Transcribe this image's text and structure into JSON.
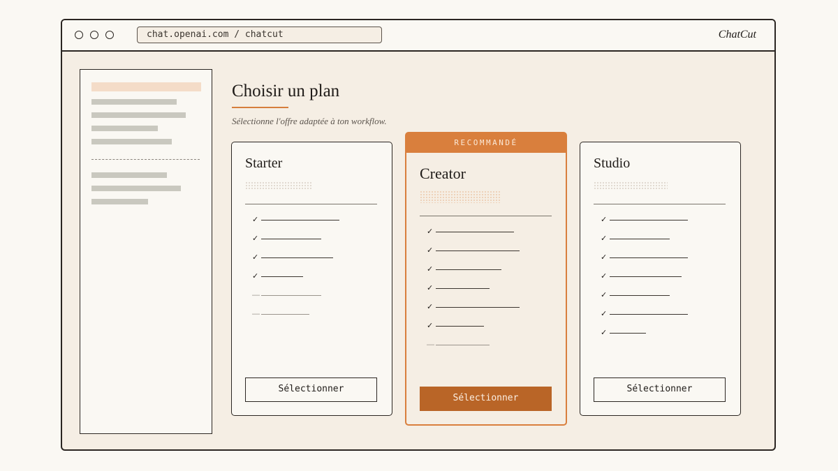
{
  "browser": {
    "url": "chat.openai.com / chatcut",
    "brand": "ChatCut"
  },
  "page": {
    "title": "Choisir un plan",
    "subtitle": "Sélectionne l'offre adaptée à ton workflow."
  },
  "plans": [
    {
      "name": "Starter",
      "featured": false,
      "features": [
        {
          "included": true,
          "length": 112
        },
        {
          "included": true,
          "length": 86
        },
        {
          "included": true,
          "length": 103
        },
        {
          "included": true,
          "length": 60
        },
        {
          "included": false,
          "length": 86
        },
        {
          "included": false,
          "length": 69
        }
      ],
      "button_label": "Sélectionner"
    },
    {
      "name": "Creator",
      "featured": true,
      "badge": "RECOMMANDÉ",
      "features": [
        {
          "included": true,
          "length": 112
        },
        {
          "included": true,
          "length": 120
        },
        {
          "included": true,
          "length": 94
        },
        {
          "included": true,
          "length": 77
        },
        {
          "included": true,
          "length": 120
        },
        {
          "included": true,
          "length": 69
        },
        {
          "included": false,
          "length": 77
        }
      ],
      "button_label": "Sélectionner"
    },
    {
      "name": "Studio",
      "featured": false,
      "features": [
        {
          "included": true,
          "length": 112
        },
        {
          "included": true,
          "length": 86
        },
        {
          "included": true,
          "length": 112
        },
        {
          "included": true,
          "length": 103
        },
        {
          "included": true,
          "length": 86
        },
        {
          "included": true,
          "length": 112
        },
        {
          "included": true,
          "length": 52
        }
      ],
      "button_label": "Sélectionner"
    }
  ],
  "icons": {
    "included": "check-icon",
    "excluded": "dash-icon"
  },
  "colors": {
    "accent": "#d97f3d",
    "accent_dark": "#b96527",
    "background": "#f5eee4",
    "ink": "#2b2622"
  }
}
